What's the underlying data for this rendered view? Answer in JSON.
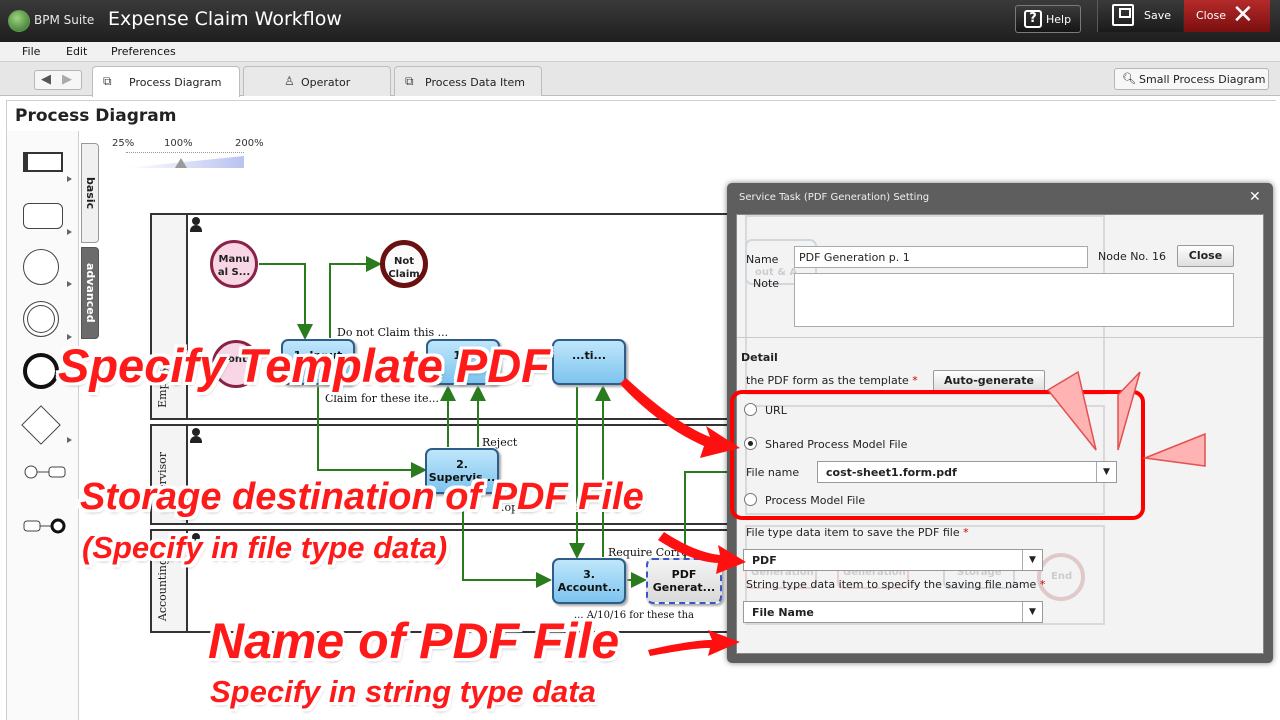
{
  "app": {
    "brand": "BPM Suite",
    "title": "Expense Claim Workflow",
    "help_label": "Help",
    "save_label": "Save",
    "close_label": "Close"
  },
  "menu": [
    "File",
    "Edit",
    "Preferences"
  ],
  "tabs": [
    {
      "label": "Process Diagram",
      "icon": "diagram-icon",
      "active": true
    },
    {
      "label": "Operator",
      "icon": "person-icon",
      "active": false
    },
    {
      "label": "Process Data Item",
      "icon": "data-item-icon",
      "active": false
    }
  ],
  "small_diagram_label": "Small Process Diagram",
  "page_title": "Process Diagram",
  "palette": {
    "basic_label": "basic",
    "advanced_label": "advanced"
  },
  "zoom": {
    "min_label": "25%",
    "mid_label": "100%",
    "max_label": "200%",
    "value_percent": 100
  },
  "diagram": {
    "lanes": [
      {
        "label": "Employee"
      },
      {
        "label": "Supervisor"
      },
      {
        "label": "Accounting"
      }
    ],
    "nodes": {
      "manual_start": "Manu\nal S...",
      "not_claim": "Not\nClaim",
      "month_start": "Month",
      "input_task": "1. Input\nE...",
      "task_1a": "1a.\n...",
      "task_ti": "...ti...",
      "supervise_task": "2.\nSupervis...",
      "accounting_task": "3.\nAccount...",
      "pdf_task": "PDF\nGenerat..."
    },
    "flow_labels": {
      "do_not_claim": "Do not Claim this ...",
      "claim": "Claim for these ite...",
      "reject": "Reject",
      "require": "Require Correc...",
      "op": "...op",
      "bottom": "... A/10/16 for these tha"
    }
  },
  "dialog": {
    "title": "Service Task (PDF Generation) Setting",
    "name_label": "Name",
    "name_value": "PDF Generation p. 1",
    "node_no": "Node No. 16",
    "close_button": "Close",
    "note_label": "Note",
    "note_value": "",
    "detail_label": "Detail",
    "template_label": "the PDF form as the template",
    "autogen_button": "Auto-generate",
    "radio_url": "URL",
    "radio_shared": "Shared Process Model File",
    "radio_process": "Process Model File",
    "selected_radio": "Shared Process Model File",
    "file_name_label": "File name",
    "file_name_value": "cost-sheet1.form.pdf",
    "file_type_label": "File type data item to save the PDF file",
    "file_type_value": "PDF",
    "string_type_label": "String type data item to specify the saving file name",
    "string_type_value": "File Name",
    "ghost": {
      "out_label": "out & A...",
      "generation_1": "Generation",
      "generation_2": "Generation",
      "storage": "Storage",
      "end": "End"
    }
  },
  "annotations": {
    "template": "Specify Template PDF",
    "storage_title": "Storage destination of PDF File",
    "storage_sub": "(Specify in file type data)",
    "name_title": "Name of PDF File",
    "name_sub": "Specify in string type data"
  },
  "colors": {
    "annotation_red": "#ff1a1a",
    "task_fill": "#7dc4ee",
    "flow_green": "#2a7a1e",
    "close_button_red": "#b52a2a"
  }
}
